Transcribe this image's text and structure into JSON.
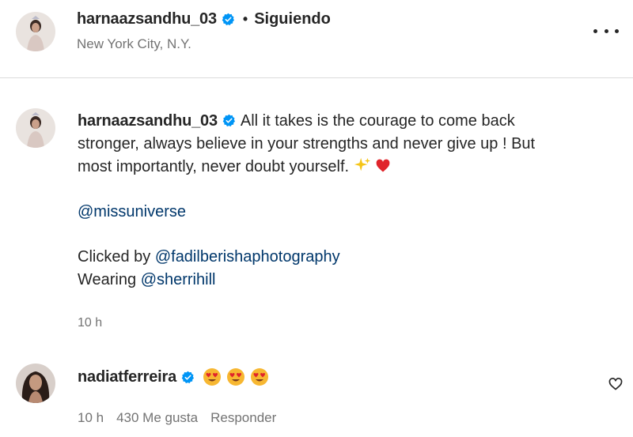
{
  "header": {
    "username": "harnaazsandhu_03",
    "separator": "•",
    "follow_status": "Siguiendo",
    "location": "New York City, N.Y.",
    "more_icon": "more-horizontal-icon"
  },
  "caption": {
    "username": "harnaazsandhu_03",
    "text_lines": [
      "All it takes is the courage to come back",
      "stronger, always believe in your strengths and never give up ! But",
      "most importantly, never doubt yourself."
    ],
    "emojis": [
      "sparkles-icon",
      "red-heart-icon"
    ],
    "mention_1": "@missuniverse",
    "clicked_by_label": "Clicked by",
    "clicked_by_mention": "@fadilberishaphotography",
    "wearing_label": "Wearing",
    "wearing_mention": "@sherrihill",
    "timestamp": "10 h"
  },
  "comment": {
    "username": "nadiatferreira",
    "emojis": [
      "heart-eyes-face-icon",
      "heart-eyes-face-icon",
      "heart-eyes-face-icon"
    ],
    "timestamp": "10 h",
    "likes": "430 Me gusta",
    "reply_label": "Responder",
    "like_icon": "heart-outline-icon"
  },
  "colors": {
    "text": "#262626",
    "secondary": "#737373",
    "mention": "#00376b",
    "verified": "#0095f6",
    "divider": "#dbdbdb"
  }
}
